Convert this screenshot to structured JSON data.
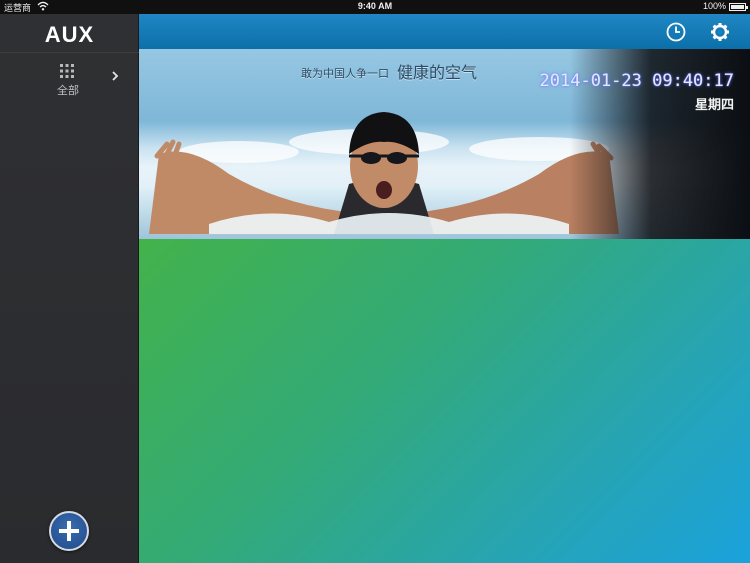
{
  "status_bar": {
    "carrier": "运营商",
    "time": "9:40 AM",
    "battery_percent": "100%",
    "battery_level": 1.0
  },
  "sidebar": {
    "logo": "AUX",
    "category": {
      "label": "全部",
      "icon": "grid-icon"
    },
    "add_icon": "plus-icon"
  },
  "toolbar": {
    "clock_icon": "clock-icon",
    "settings_icon": "gear-icon"
  },
  "banner": {
    "slogan_small": "敢为中国人争一口",
    "slogan_large": "健康的空气",
    "datetime": "2014-01-23 09:40:17",
    "weekday": "星期四"
  },
  "colors": {
    "sidebar": "#2f3033",
    "toolbar": "#1a80be",
    "main_gradient_start": "#43b24b",
    "main_gradient_end": "#1aa2dc",
    "add_button": "#2b5c9e"
  }
}
